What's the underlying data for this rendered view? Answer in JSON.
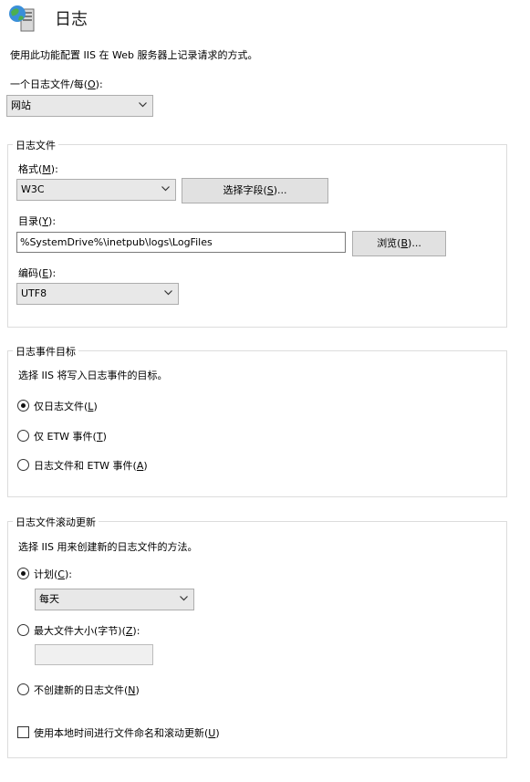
{
  "header": {
    "title": "日志",
    "icon": "globe-server-icon"
  },
  "description": "使用此功能配置 IIS 在 Web 服务器上记录请求的方式。",
  "per": {
    "label": "一个日志文件/每(",
    "key": "O",
    "suffix": "):",
    "value": "网站"
  },
  "log_file": {
    "legend": "日志文件",
    "format": {
      "label": "格式(",
      "key": "M",
      "suffix": "):",
      "value": "W3C"
    },
    "select_fields": {
      "label": "选择字段(",
      "key": "S",
      "suffix": ")..."
    },
    "directory": {
      "label": "目录(",
      "key": "Y",
      "suffix": "):",
      "value": "%SystemDrive%\\inetpub\\logs\\LogFiles"
    },
    "browse": {
      "label": "浏览(",
      "key": "B",
      "suffix": ")..."
    },
    "encoding": {
      "label": "编码(",
      "key": "E",
      "suffix": "):",
      "value": "UTF8"
    }
  },
  "event_destination": {
    "legend": "日志事件目标",
    "desc": "选择 IIS 将写入日志事件的目标。",
    "options": [
      {
        "label": "仅日志文件(",
        "key": "L",
        "suffix": ")",
        "checked": true
      },
      {
        "label": "仅 ETW 事件(",
        "key": "T",
        "suffix": ")",
        "checked": false
      },
      {
        "label": "日志文件和 ETW 事件(",
        "key": "A",
        "suffix": ")",
        "checked": false
      }
    ]
  },
  "rollover": {
    "legend": "日志文件滚动更新",
    "desc": "选择 IIS 用来创建新的日志文件的方法。",
    "schedule": {
      "label": "计划(",
      "key": "C",
      "suffix": "):",
      "checked": true,
      "value": "每天"
    },
    "max_size": {
      "label": "最大文件大小(字节)(",
      "key": "Z",
      "suffix": "):",
      "checked": false,
      "value": ""
    },
    "none": {
      "label": "不创建新的日志文件(",
      "key": "N",
      "suffix": ")",
      "checked": false
    },
    "local_time": {
      "label": "使用本地时间进行文件命名和滚动更新(",
      "key": "U",
      "suffix": ")",
      "checked": false
    }
  }
}
